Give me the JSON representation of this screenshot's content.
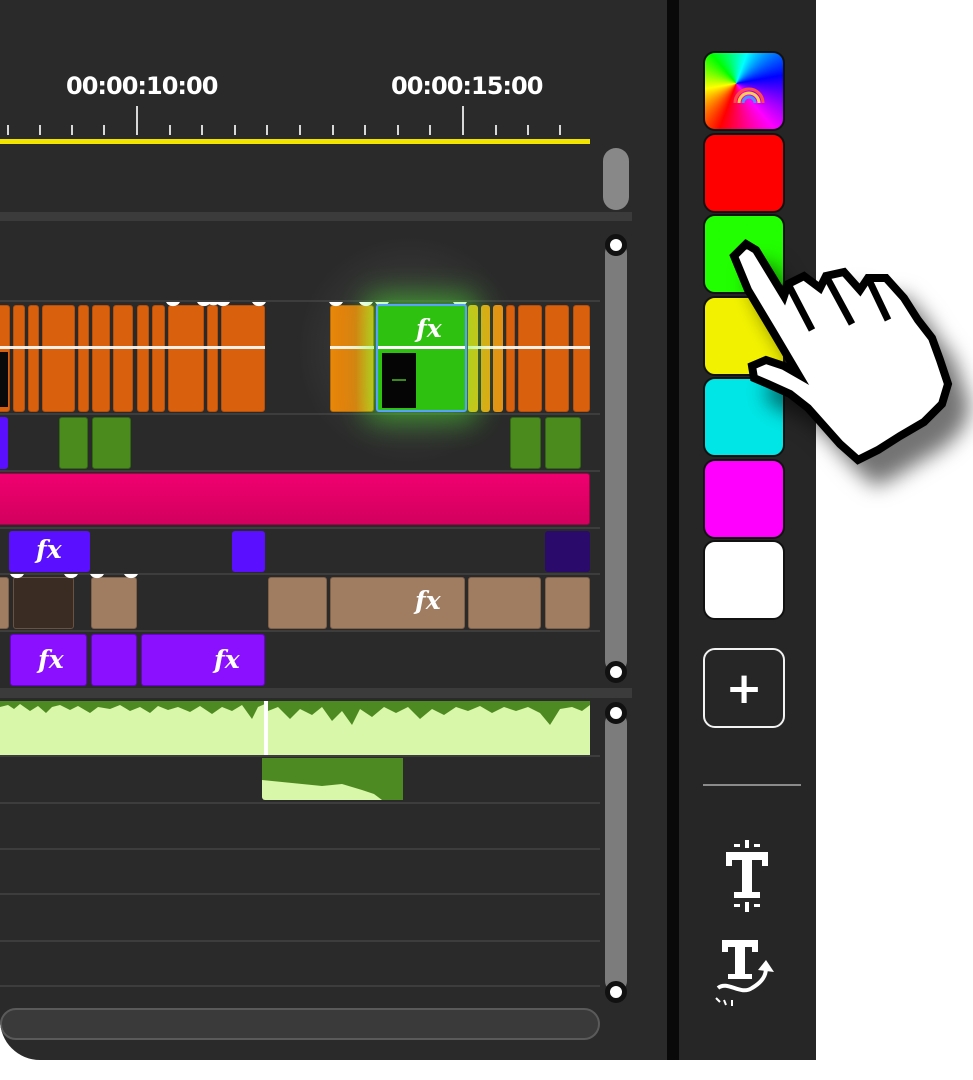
{
  "timeline": {
    "timecodes": [
      "00:00:10:00",
      "00:00:15:00"
    ],
    "fx_label": "fx"
  },
  "colors": {
    "orange_clip": "#d9600c",
    "green_clip": "#2fc10f",
    "magenta_track": "#e6006b",
    "purple_clip": "#8a10ff",
    "tan_clip": "#a07c60",
    "audio_wave": "#d9f7a8",
    "playhead_line": "#f1e400"
  },
  "sidebar": {
    "swatches": [
      {
        "name": "rainbow",
        "color": "rainbow"
      },
      {
        "name": "red",
        "color": "#ff0000"
      },
      {
        "name": "green",
        "color": "#22ff00"
      },
      {
        "name": "yellow",
        "color": "#f2f200"
      },
      {
        "name": "cyan",
        "color": "#00e6e6"
      },
      {
        "name": "magenta",
        "color": "#ff00ff"
      },
      {
        "name": "white",
        "color": "#ffffff"
      }
    ],
    "add_label": "+",
    "tools": [
      {
        "icon": "text-split-icon",
        "glyph": "T"
      },
      {
        "icon": "text-animate-icon",
        "glyph": "T"
      }
    ]
  },
  "cursor": {
    "icon": "hand-pointer-icon"
  }
}
